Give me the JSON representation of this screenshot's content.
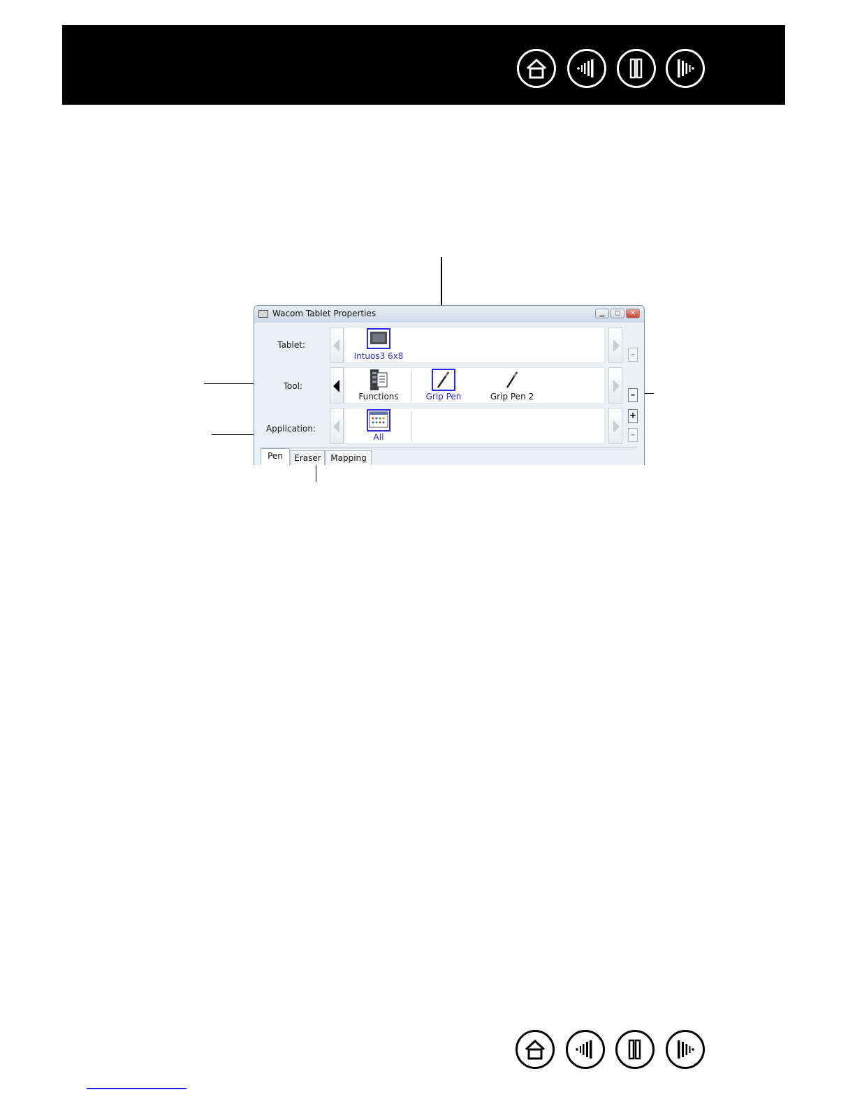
{
  "nav": {
    "top": [
      {
        "name": "home-icon"
      },
      {
        "name": "contents-icon"
      },
      {
        "name": "index-icon"
      },
      {
        "name": "next-page-icon"
      }
    ],
    "bottom": [
      {
        "name": "home-icon"
      },
      {
        "name": "contents-icon"
      },
      {
        "name": "index-icon"
      },
      {
        "name": "next-page-icon"
      }
    ]
  },
  "dialog": {
    "title": "Wacom Tablet Properties",
    "window_buttons": [
      "minimize-icon",
      "maximize-icon",
      "close-icon"
    ],
    "rows": {
      "tablet": {
        "label": "Tablet:",
        "items": [
          {
            "label": "Intuos3 6x8",
            "selected": true,
            "icon": "tablet-icon"
          }
        ]
      },
      "tool": {
        "label": "Tool:",
        "items": [
          {
            "label": "Functions",
            "selected": false,
            "icon": "functions-icon"
          },
          {
            "label": "Grip Pen",
            "selected": true,
            "icon": "pen-icon"
          },
          {
            "label": "Grip Pen 2",
            "selected": false,
            "icon": "pen-icon"
          }
        ]
      },
      "application": {
        "label": "Application:",
        "items": [
          {
            "label": "All",
            "selected": true,
            "icon": "application-icon"
          }
        ]
      }
    },
    "side_buttons": {
      "tablet_minus": "–",
      "tool_minus": "–",
      "app_plus": "+",
      "app_minus": "–"
    },
    "tabs": [
      "Pen",
      "Eraser",
      "Mapping"
    ]
  },
  "colors": {
    "header": "#000000",
    "selected_label": "#2a2ae0",
    "footer_link": "#2323e6"
  }
}
